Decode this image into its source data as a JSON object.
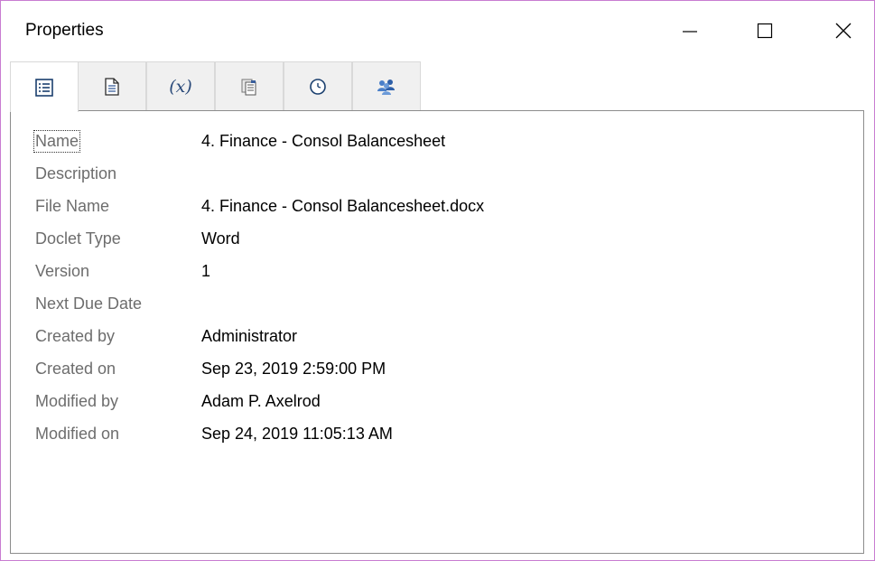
{
  "window": {
    "title": "Properties",
    "border_color": "#c97cd1"
  },
  "tabs": [
    {
      "name": "general",
      "icon": "property-list-icon",
      "active": true
    },
    {
      "name": "document",
      "icon": "document-icon",
      "active": false
    },
    {
      "name": "variables",
      "icon": "variable-icon",
      "label": "(x)",
      "active": false
    },
    {
      "name": "book",
      "icon": "book-pages-icon",
      "active": false
    },
    {
      "name": "history",
      "icon": "clock-icon",
      "active": false
    },
    {
      "name": "users",
      "icon": "users-group-icon",
      "active": false
    }
  ],
  "properties": [
    {
      "label": "Name",
      "value": "4. Finance - Consol Balancesheet"
    },
    {
      "label": "Description",
      "value": ""
    },
    {
      "label": "File Name",
      "value": "4. Finance - Consol Balancesheet.docx"
    },
    {
      "label": "Doclet Type",
      "value": "Word"
    },
    {
      "label": "Version",
      "value": "1"
    },
    {
      "label": "Next Due Date",
      "value": ""
    },
    {
      "label": "Created by",
      "value": "Administrator"
    },
    {
      "label": "Created on",
      "value": "Sep 23, 2019 2:59:00 PM"
    },
    {
      "label": "Modified by",
      "value": "Adam P. Axelrod"
    },
    {
      "label": "Modified on",
      "value": "Sep 24, 2019 11:05:13 AM"
    }
  ]
}
